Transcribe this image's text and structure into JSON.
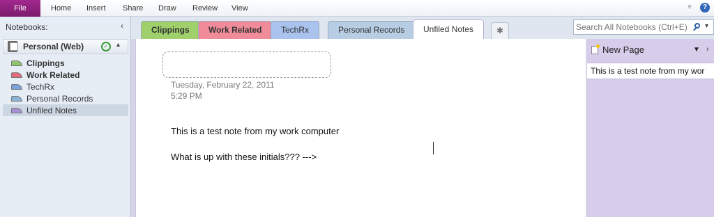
{
  "ribbon": {
    "file": "File",
    "menu": [
      "Home",
      "Insert",
      "Share",
      "Draw",
      "Review",
      "View"
    ]
  },
  "nav": {
    "header": "Notebooks:",
    "collapse_glyph": "‹",
    "notebook": "Personal (Web)",
    "sections": [
      {
        "label": "Clippings",
        "color": "#8fc46a",
        "bold": true
      },
      {
        "label": "Work Related",
        "color": "#e06b7c",
        "bold": true
      },
      {
        "label": "TechRx",
        "color": "#7ea2e0",
        "bold": false
      },
      {
        "label": "Personal Records",
        "color": "#8cb4d8",
        "bold": false
      },
      {
        "label": "Unfiled Notes",
        "color": "#a98fd6",
        "bold": false
      }
    ]
  },
  "tabs": [
    {
      "label": "Clippings",
      "color": "#9fd06b",
      "bold": true
    },
    {
      "label": "Work Related",
      "color": "#f08b9a",
      "bold": true
    },
    {
      "label": "TechRx",
      "color": "#a9c2ee",
      "bold": false
    },
    {
      "label": "Personal Records",
      "color": "#b7cde3",
      "bold": false
    },
    {
      "label": "Unfiled Notes",
      "color": "#ffffff",
      "bold": false,
      "active": true
    }
  ],
  "search": {
    "placeholder": "Search All Notebooks (Ctrl+E)"
  },
  "page": {
    "date": "Tuesday, February 22, 2011",
    "time": "5:29 PM",
    "lines": [
      "This is a test note from my work computer",
      "What is up with these initials??? --->"
    ]
  },
  "page_list": {
    "new_page": "New Page",
    "entries": [
      "This is a test note from my wor"
    ]
  },
  "colors": {
    "file_tab": "#8f2180",
    "page_list_bg": "#d7cdeb"
  }
}
